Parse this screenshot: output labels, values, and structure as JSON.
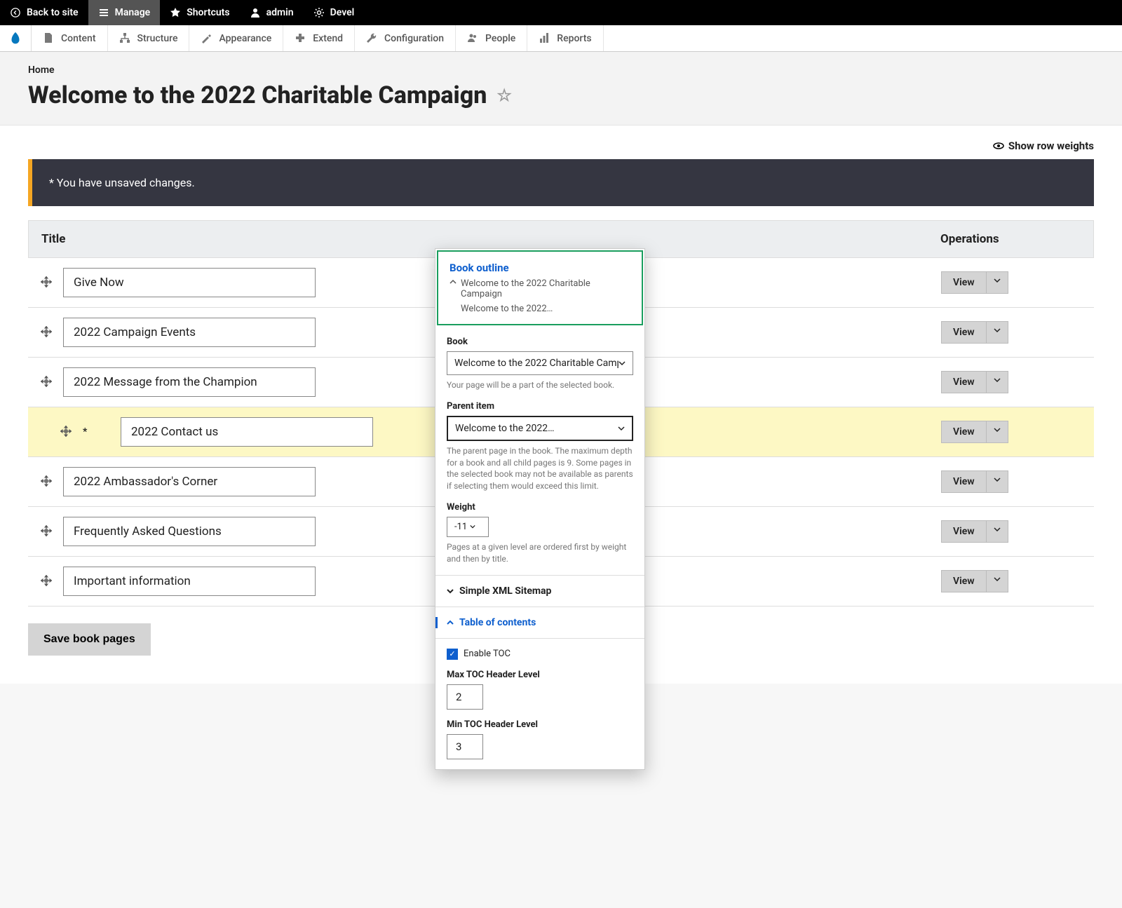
{
  "toolbar_black": {
    "back": "Back to site",
    "manage": "Manage",
    "shortcuts": "Shortcuts",
    "user": "admin",
    "devel": "Devel"
  },
  "toolbar_admin": {
    "content": "Content",
    "structure": "Structure",
    "appearance": "Appearance",
    "extend": "Extend",
    "configuration": "Configuration",
    "people": "People",
    "reports": "Reports"
  },
  "breadcrumb": "Home",
  "page_title": "Welcome to the 2022 Charitable Campaign",
  "show_row_weights": "Show row weights",
  "warning": "* You have unsaved changes.",
  "table": {
    "col_title": "Title",
    "col_ops": "Operations",
    "view_label": "View",
    "rows": [
      {
        "title": "Give Now"
      },
      {
        "title": "2022 Campaign Events"
      },
      {
        "title": "2022 Message from the Champion"
      },
      {
        "title": "2022 Contact us",
        "modified": true,
        "indent": true,
        "highlight": true
      },
      {
        "title": "2022 Ambassador's Corner"
      },
      {
        "title": "Frequently Asked Questions"
      },
      {
        "title": "Important information"
      }
    ]
  },
  "save_button": "Save book pages",
  "panel": {
    "outline_title": "Book outline",
    "outline_sub1": "Welcome to the 2022 Charitable Campaign",
    "outline_sub2": "Welcome to the 2022…",
    "book_label": "Book",
    "book_value": "Welcome to the 2022 Charitable Camp",
    "book_help": "Your page will be a part of the selected book.",
    "parent_label": "Parent item",
    "parent_value": "Welcome to the 2022…",
    "parent_help": "The parent page in the book. The maximum depth for a book and all child pages is 9. Some pages in the selected book may not be available as parents if selecting them would exceed this limit.",
    "weight_label": "Weight",
    "weight_value": "-11",
    "weight_help": "Pages at a given level are ordered first by weight and then by title.",
    "xml_sitemap": "Simple XML Sitemap",
    "toc_title": "Table of contents",
    "enable_toc": "Enable TOC",
    "max_toc_label": "Max TOC Header Level",
    "max_toc_value": "2",
    "min_toc_label": "Min TOC Header Level",
    "min_toc_value": "3"
  }
}
